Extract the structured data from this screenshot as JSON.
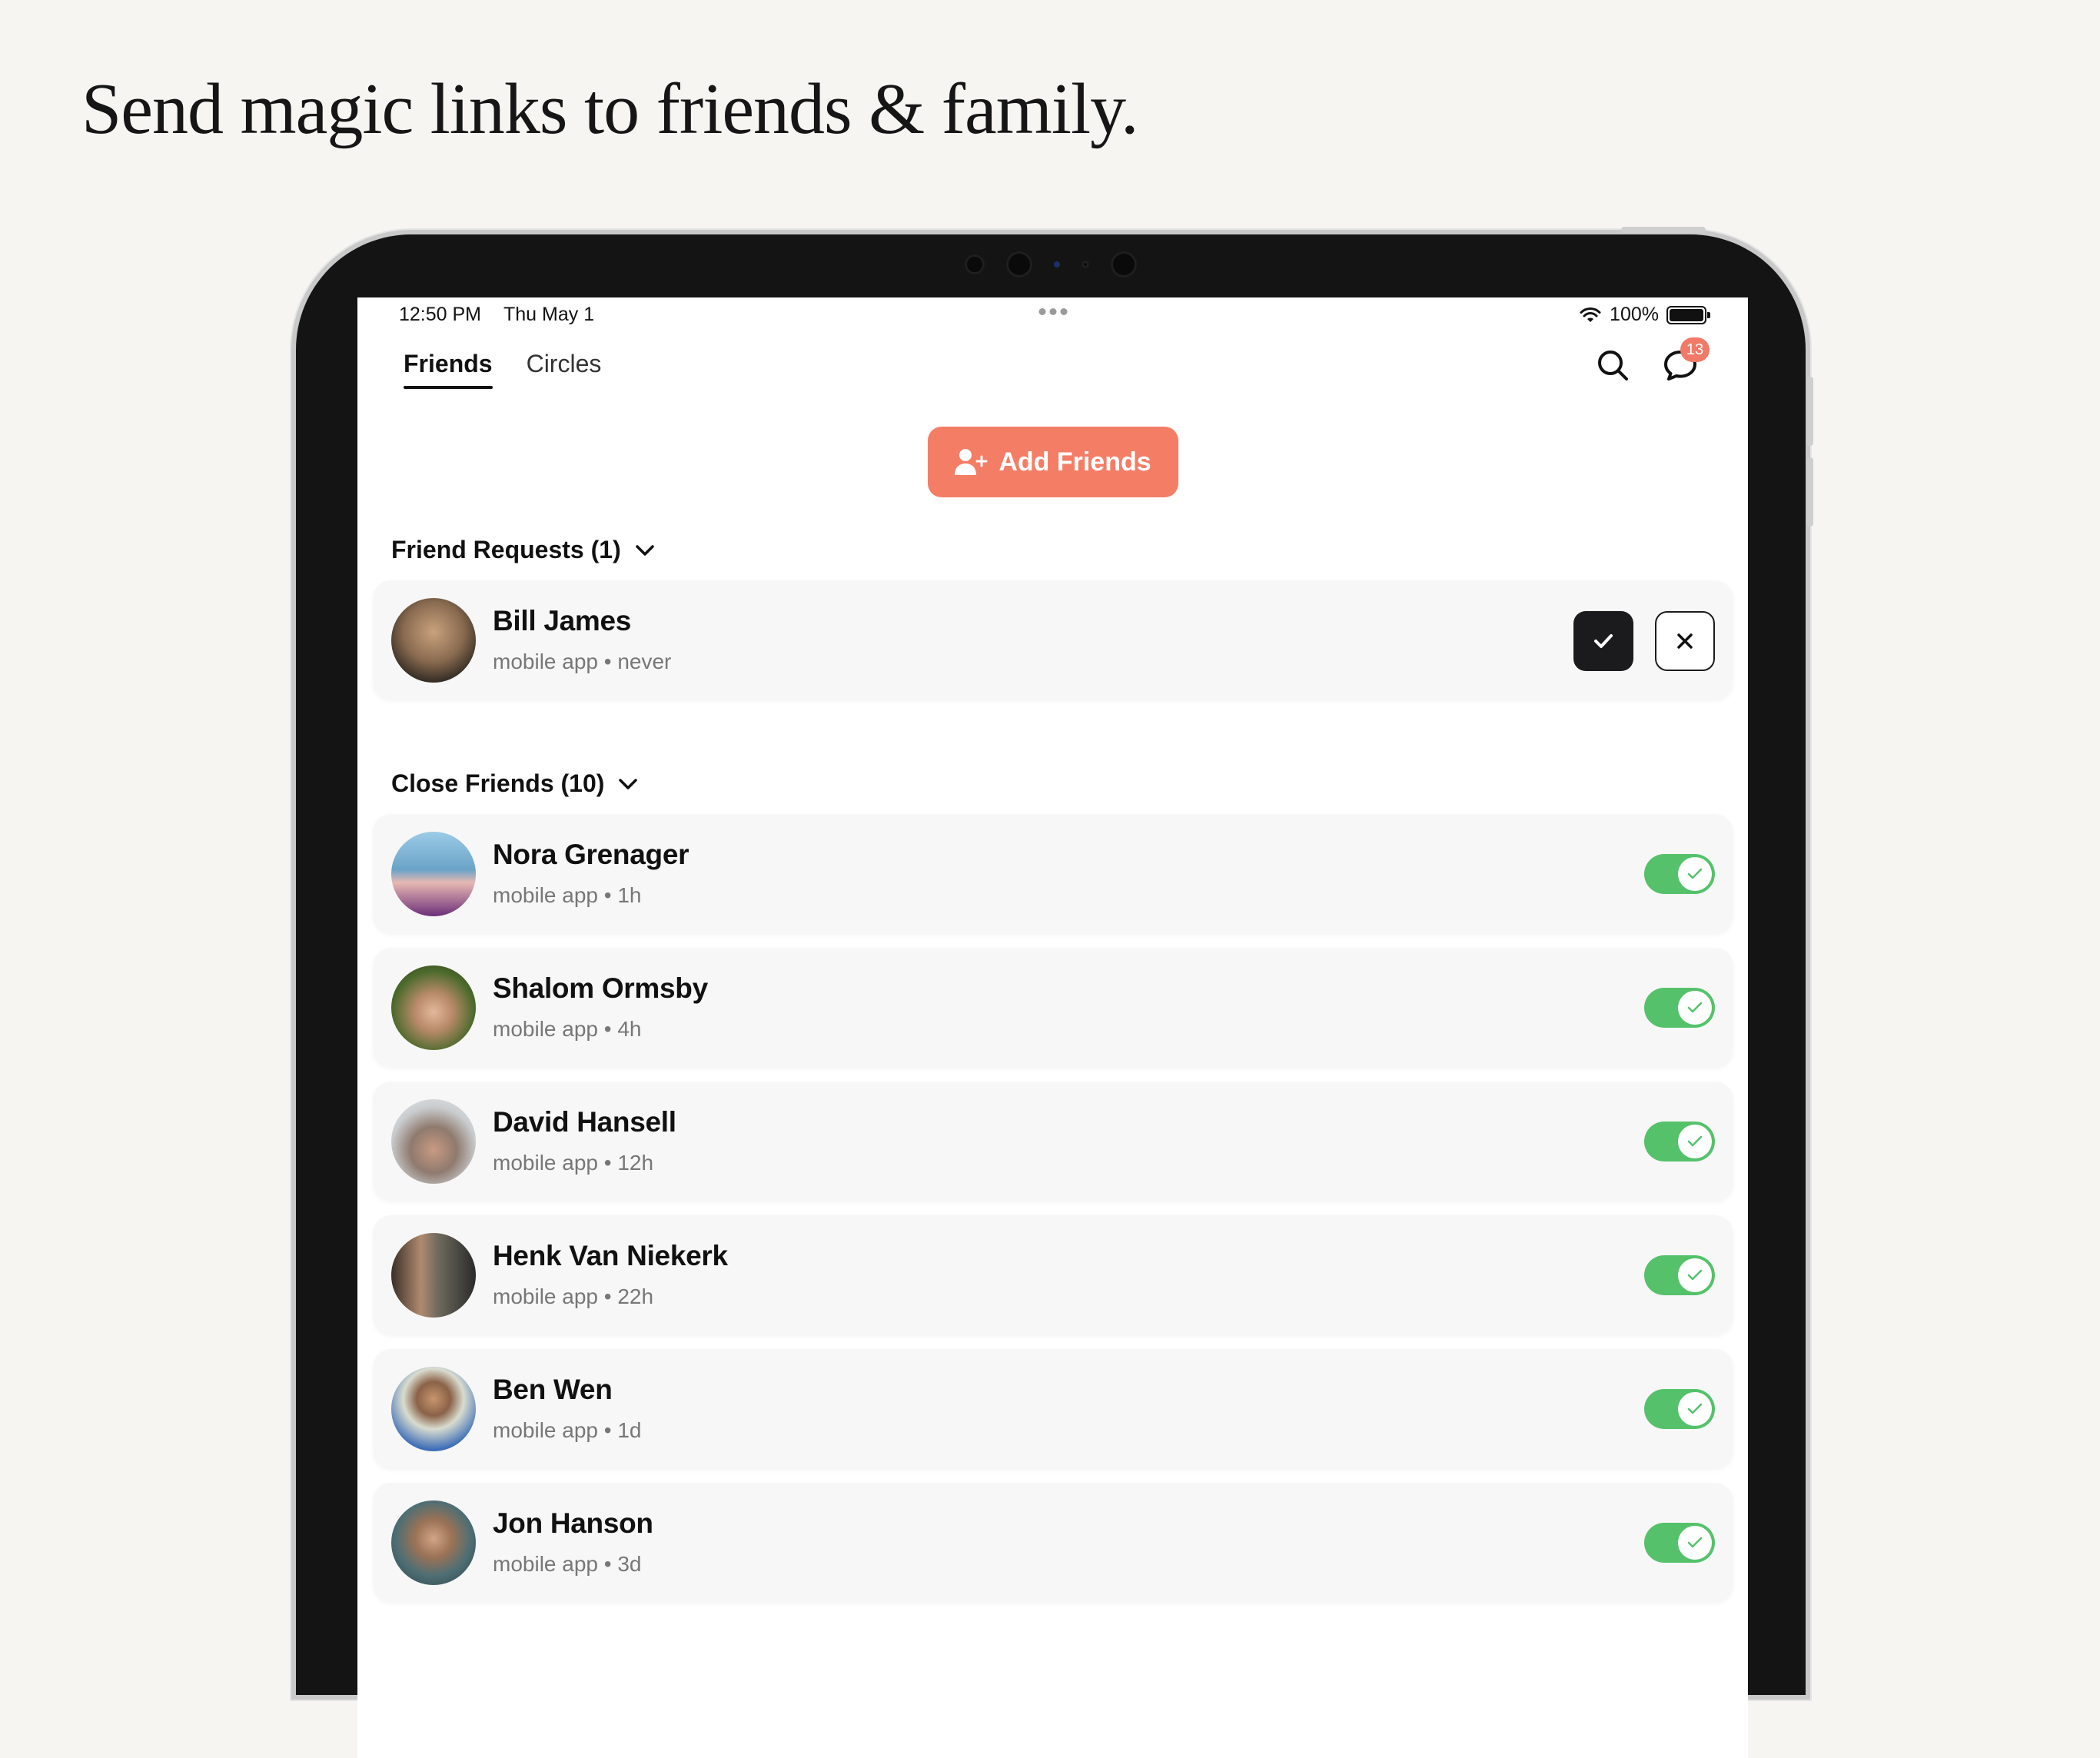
{
  "headline": "Send magic links to friends & family.",
  "status_bar": {
    "time": "12:50 PM",
    "date": "Thu May 1",
    "battery": "100%"
  },
  "tabs": [
    {
      "label": "Friends",
      "active": true
    },
    {
      "label": "Circles",
      "active": false
    }
  ],
  "messages_badge": "13",
  "add_friends_label": "Add Friends",
  "friend_requests": {
    "title": "Friend Requests (1)",
    "items": [
      {
        "name": "Bill James",
        "sub": "mobile app • never",
        "avatar_color": "#8a6b50"
      }
    ]
  },
  "close_friends": {
    "title": "Close Friends (10)",
    "items": [
      {
        "name": "Nora Grenager",
        "sub": "mobile app • 1h",
        "avatar_color": "#6aa3c8",
        "enabled": true
      },
      {
        "name": "Shalom Ormsby",
        "sub": "mobile app • 4h",
        "avatar_color": "#7a9a4e",
        "enabled": true
      },
      {
        "name": "David Hansell",
        "sub": "mobile app • 12h",
        "avatar_color": "#9c9ea0",
        "enabled": true
      },
      {
        "name": "Henk Van Niekerk",
        "sub": "mobile app • 22h",
        "avatar_color": "#6f6a5e",
        "enabled": true
      },
      {
        "name": "Ben Wen",
        "sub": "mobile app • 1d",
        "avatar_color": "#5a7fb4",
        "enabled": true
      },
      {
        "name": "Jon Hanson",
        "sub": "mobile app • 3d",
        "avatar_color": "#4d6e74",
        "enabled": true
      }
    ]
  },
  "colors": {
    "accent": "#f47d65",
    "toggle_on": "#55c26b",
    "background": "#f6f5f1"
  }
}
